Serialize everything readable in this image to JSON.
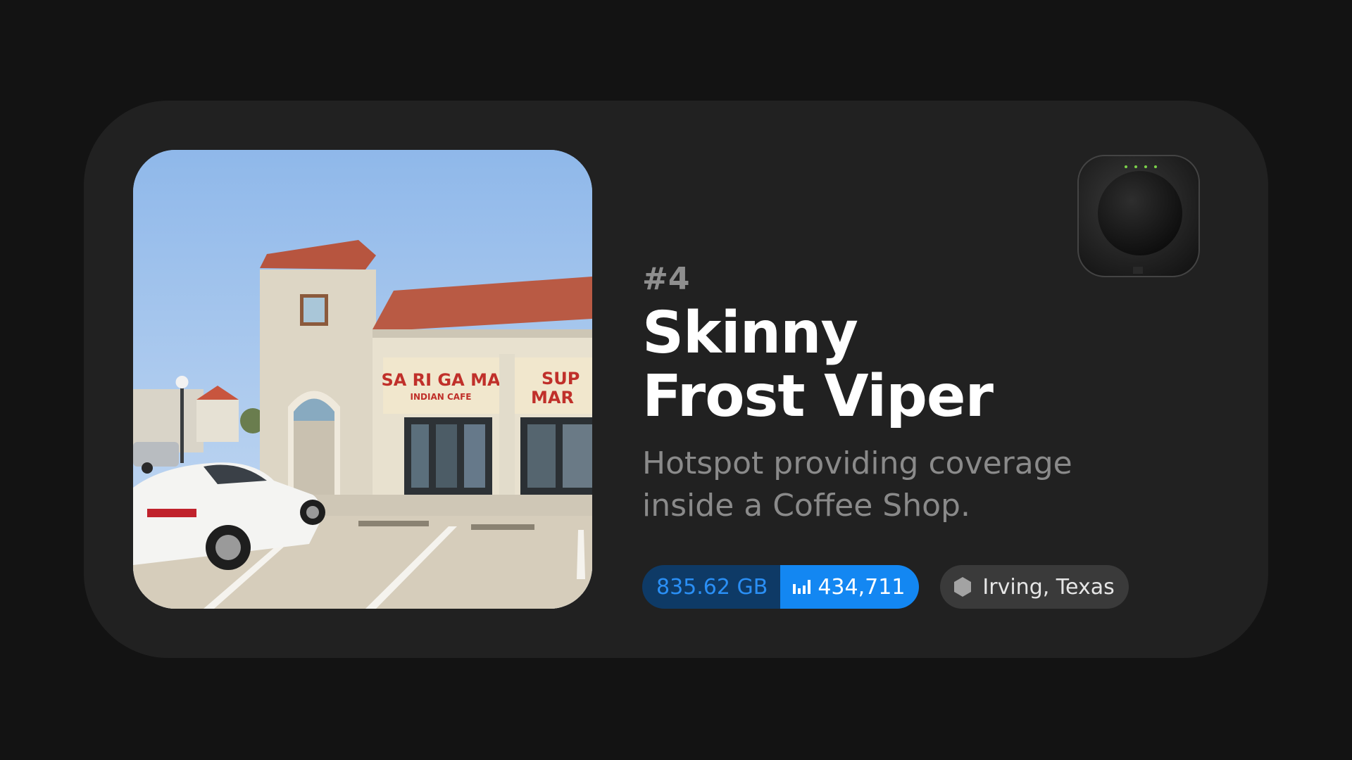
{
  "hotspot": {
    "rank": "#4",
    "name_line1": "Skinny",
    "name_line2": "Frost Viper",
    "description": "Hotspot providing coverage inside a Coffee Shop.",
    "data_transferred": "835.62 GB",
    "rewards_count": "434,711",
    "location": "Irving, Texas"
  },
  "photo": {
    "storefront_sign_left_line1": "SA RI GA MA",
    "storefront_sign_left_line2": "INDIAN CAFE",
    "storefront_sign_right_line1": "SUP",
    "storefront_sign_right_line2": "MAR"
  },
  "icons": {
    "stats": "bar-chart-icon",
    "location": "hexagon-icon"
  },
  "colors": {
    "background": "#131313",
    "card": "#212121",
    "data_pill_dark": "#0e3a66",
    "data_pill_text": "#2a8ff5",
    "data_pill_accent": "#1387f2",
    "location_pill": "#3a3a3a"
  }
}
